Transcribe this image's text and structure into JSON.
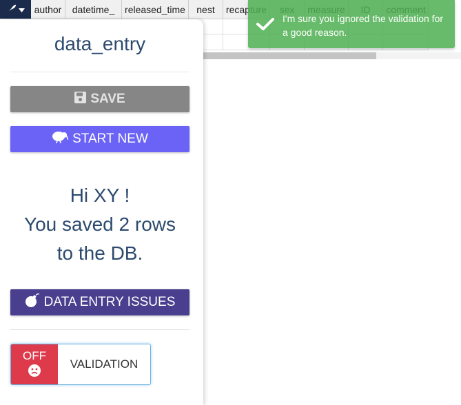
{
  "grid": {
    "columns": [
      "author",
      "datetime_",
      "released_time",
      "nest",
      "recapture",
      "sex",
      "measure",
      "ID",
      "comment"
    ]
  },
  "sidebar": {
    "title": "data_entry",
    "save_label": "SAVE",
    "start_new_label": "START NEW",
    "greeting_line1": "Hi XY !",
    "greeting_line2": "You saved 2 rows",
    "greeting_line3": "to the DB.",
    "issues_label": "DATA ENTRY ISSUES",
    "validation": {
      "state_label": "OFF",
      "label": "VALIDATION"
    }
  },
  "toast": {
    "message": "I'm sure you ignored the validation for a good reason."
  },
  "colors": {
    "save": "#868686",
    "start_new": "#6a63f5",
    "issues": "#4a3f8f",
    "toggle_off": "#dd3b4b",
    "toast": "#4caf50",
    "title_text": "#2c4a6e"
  },
  "icons": {
    "corner": [
      "feather-icon",
      "caret-down-icon"
    ],
    "save": "floppy-disk-icon",
    "start_new": "kiwi-bird-icon",
    "issues": "bomb-icon",
    "toggle": "sad-face-icon",
    "toast": "checkmark-icon"
  }
}
